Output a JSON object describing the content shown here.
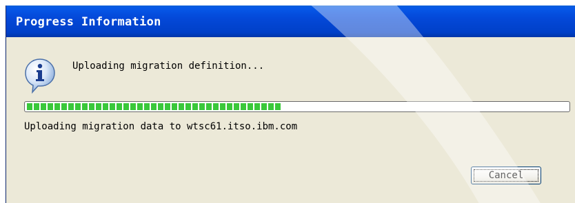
{
  "window": {
    "title": "Progress Information"
  },
  "dialog": {
    "message": "Uploading migration definition...",
    "sub_message": "Uploading migration data to wtsc61.itso.ibm.com",
    "progress_fraction": 0.47,
    "cancel_label": "Cancel",
    "icon": "info-icon"
  },
  "colors": {
    "titlebar": "#0448d8",
    "progress_fill": "#3ac83a",
    "dialog_bg": "#ece9d8"
  }
}
